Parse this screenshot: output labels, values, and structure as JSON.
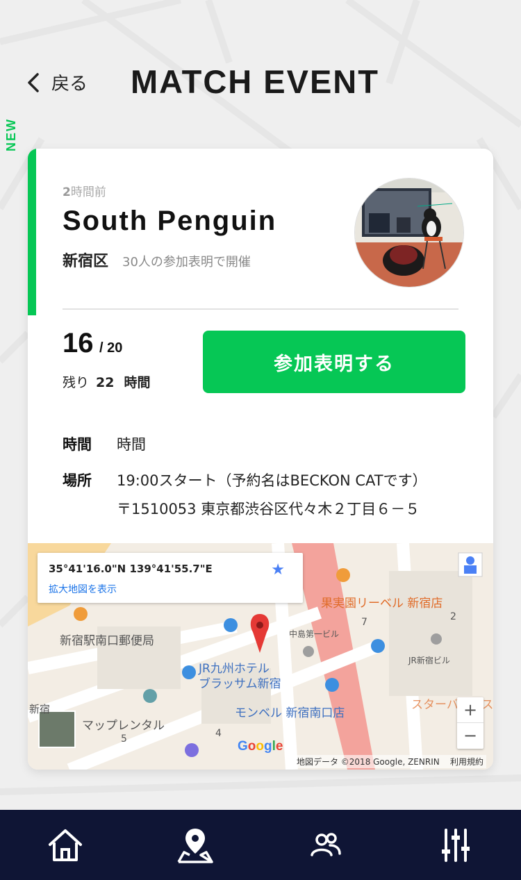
{
  "header": {
    "back_label": "戻る",
    "title": "MATCH EVENT"
  },
  "event": {
    "badge": "NEW",
    "posted_num": "2",
    "posted_suffix": "時間前",
    "name": "South Penguin",
    "area": "新宿区",
    "participants_note": "30人の参加表明で開催",
    "count_current": "16",
    "count_sep": "/ 20",
    "remaining_prefix": "残り",
    "remaining_value": "22",
    "remaining_unit": "時間",
    "join_button": "参加表明する",
    "time_label": "時間",
    "time_value": "時間",
    "place_label": "場所",
    "place_line1": "19:00スタート（予約名はBECKON CATです）",
    "place_line2": "〒1510053 東京都渋谷区代々木２丁目６－５"
  },
  "map": {
    "coords": "35°41'16.0\"N 139°41'55.7\"E",
    "enlarge_link": "拡大地図を表示",
    "labels": {
      "fruit_shop": "果実園リーベル 新宿店",
      "post_office": "新宿駅南口郵便局",
      "nakajima": "中島第一ビル",
      "jr_building": "JR新宿ビル",
      "hotel": "JR九州ホテル\nブラッサム新宿",
      "starbucks": "スターバックス",
      "monbell": "モンベル 新宿南口店",
      "maprental": "マップレンタル",
      "shinjuku": "新宿",
      "num7": "7",
      "num2": "2",
      "num4": "4",
      "num5": "5"
    },
    "google_logo": "Google",
    "copyright": "地図データ ©2018 Google, ZENRIN",
    "terms": "利用規約",
    "zoom_in": "+",
    "zoom_out": "−"
  },
  "nav": {
    "items": [
      {
        "icon": "home-icon"
      },
      {
        "icon": "map-pin-icon"
      },
      {
        "icon": "people-icon"
      },
      {
        "icon": "sliders-icon"
      }
    ]
  },
  "colors": {
    "accent": "#06c755",
    "nav_bg": "#0f1535"
  }
}
